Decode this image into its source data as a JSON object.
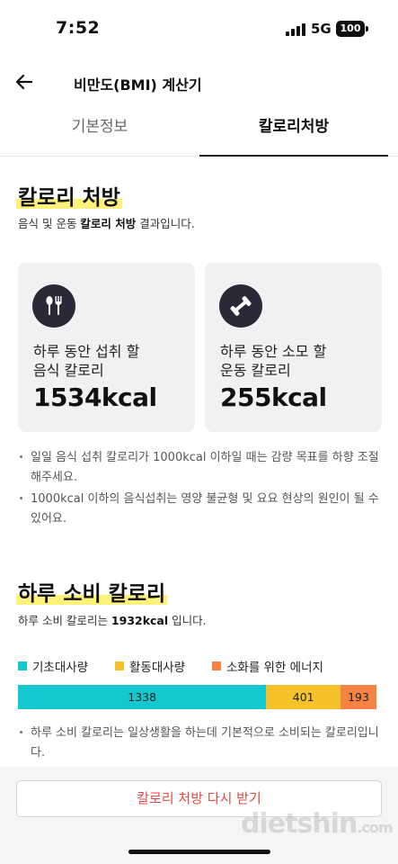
{
  "status_bar": {
    "time": "7:52",
    "network": "5G",
    "battery": "100"
  },
  "header": {
    "title": "비만도(BMI) 계산기",
    "back_icon": "arrow-left-icon"
  },
  "tabs": [
    {
      "label": "기본정보",
      "active": false
    },
    {
      "label": "칼로리처방",
      "active": true
    }
  ],
  "prescription": {
    "title": "칼로리 처방",
    "subtitle_prefix": "음식 및 운동 ",
    "subtitle_bold": "칼로리 처방",
    "subtitle_suffix": " 결과입니다.",
    "cards": [
      {
        "icon": "fork-spoon-icon",
        "label": "하루 동안 섭취 할\n음식 칼로리",
        "value": "1534kcal"
      },
      {
        "icon": "dumbbell-icon",
        "label": "하루 동안 소모 할\n운동 칼로리",
        "value": "255kcal"
      }
    ],
    "notes": [
      "일일 음식 섭취 칼로리가 1000kcal 이하일 때는 감량 목표를 하향 조절해주세요.",
      "1000kcal 이하의 음식섭취는 영양 불균형 및 요요 현상의 원인이 될 수 있어요."
    ]
  },
  "daily": {
    "title": "하루 소비 칼로리",
    "subtitle_prefix": "하루 소비 칼로리는 ",
    "subtitle_bold": "1932kcal",
    "subtitle_suffix": " 입니다.",
    "legend": [
      {
        "label": "기초대사량",
        "color": "#14c8cf"
      },
      {
        "label": "활동대사량",
        "color": "#f6c22c"
      },
      {
        "label": "소화를 위한 에너지",
        "color": "#f58442"
      }
    ],
    "segments": [
      {
        "value": 1338,
        "label": "1338",
        "color": "#14c8cf"
      },
      {
        "value": 401,
        "label": "401",
        "color": "#f6c22c"
      },
      {
        "value": 193,
        "label": "193",
        "color": "#f58442"
      }
    ],
    "note": "하루 소비 칼로리는 일상생활을 하는데 기본적으로 소비되는 칼로리입니다."
  },
  "retry_button": "칼로리 처방 다시 받기",
  "watermark": {
    "main": "dietshin",
    "suffix": ".com"
  }
}
